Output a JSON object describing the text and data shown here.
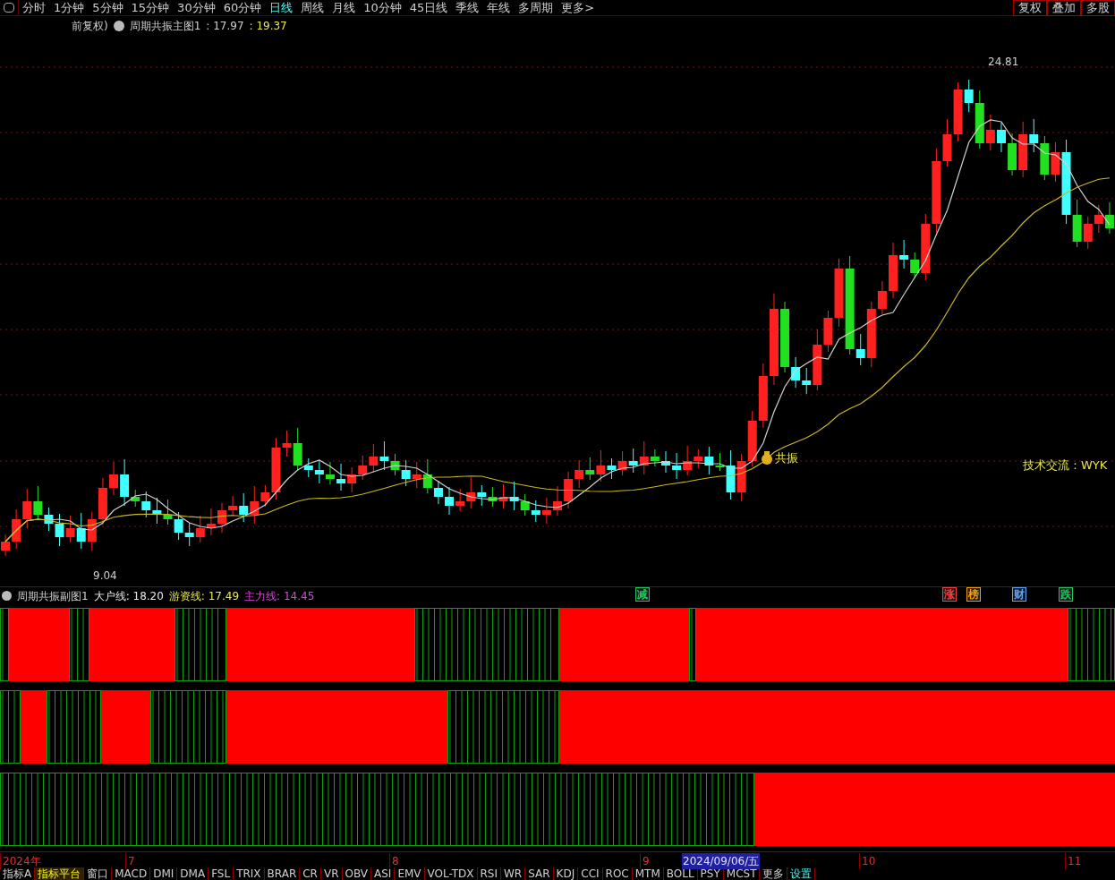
{
  "period_bar": {
    "items": [
      {
        "label": "分时",
        "selected": false
      },
      {
        "label": "1分钟",
        "selected": false
      },
      {
        "label": "5分钟",
        "selected": false
      },
      {
        "label": "15分钟",
        "selected": false
      },
      {
        "label": "30分钟",
        "selected": false
      },
      {
        "label": "60分钟",
        "selected": false
      },
      {
        "label": "日线",
        "selected": true
      },
      {
        "label": "周线",
        "selected": false
      },
      {
        "label": "月线",
        "selected": false
      },
      {
        "label": "10分钟",
        "selected": false
      },
      {
        "label": "45日线",
        "selected": false
      },
      {
        "label": "季线",
        "selected": false
      },
      {
        "label": "年线",
        "selected": false
      },
      {
        "label": "多周期",
        "selected": false
      },
      {
        "label": "更多>",
        "selected": false
      }
    ],
    "buttons": [
      "复权",
      "叠加",
      "多股"
    ]
  },
  "main_chart": {
    "header": {
      "adjust": "前复权)",
      "indicator": "周期共振主图1",
      "value_1": ": 17.97",
      "value_2": ": 19.37"
    },
    "high_label": "24.81",
    "low_label": "9.04",
    "signal_label": "共振",
    "note": "技术交流：WYK",
    "markers": [
      {
        "text": "减",
        "color": "#22c55e"
      },
      {
        "text": "涨",
        "color": "#ef4444"
      },
      {
        "text": "榜",
        "color": "#f59e0b"
      },
      {
        "text": "财",
        "color": "#60a5fa"
      },
      {
        "text": "跌",
        "color": "#22c55e"
      }
    ]
  },
  "sub_chart": {
    "title": "周期共振副图1",
    "values": [
      {
        "label": "大户线: 18.20",
        "color": "#e5e5e5"
      },
      {
        "label": "游资线: 17.49",
        "color": "#e8e84a"
      },
      {
        "label": "主力线: 14.45",
        "color": "#e040e0"
      }
    ]
  },
  "date_axis": [
    {
      "label": "2024年",
      "selected": false
    },
    {
      "label": "7",
      "selected": false
    },
    {
      "label": "8",
      "selected": false
    },
    {
      "label": "9",
      "selected": false
    },
    {
      "label": "2024/09/06/五",
      "selected": true
    },
    {
      "label": "10",
      "selected": false
    },
    {
      "label": "11",
      "selected": false
    }
  ],
  "indicator_tabs": [
    {
      "label": "指标A",
      "selected": false,
      "kind": "tab"
    },
    {
      "label": "指标平台",
      "selected": true,
      "kind": "tab"
    },
    {
      "label": "窗口",
      "selected": false,
      "kind": "tab"
    },
    {
      "label": "MACD",
      "selected": false,
      "kind": "tab"
    },
    {
      "label": "DMI",
      "selected": false,
      "kind": "tab"
    },
    {
      "label": "DMA",
      "selected": false,
      "kind": "tab"
    },
    {
      "label": "FSL",
      "selected": false,
      "kind": "tab"
    },
    {
      "label": "TRIX",
      "selected": false,
      "kind": "tab"
    },
    {
      "label": "BRAR",
      "selected": false,
      "kind": "tab"
    },
    {
      "label": "CR",
      "selected": false,
      "kind": "tab"
    },
    {
      "label": "VR",
      "selected": false,
      "kind": "tab"
    },
    {
      "label": "OBV",
      "selected": false,
      "kind": "tab"
    },
    {
      "label": "ASI",
      "selected": false,
      "kind": "tab"
    },
    {
      "label": "EMV",
      "selected": false,
      "kind": "tab"
    },
    {
      "label": "VOL-TDX",
      "selected": false,
      "kind": "tab"
    },
    {
      "label": "RSI",
      "selected": false,
      "kind": "tab"
    },
    {
      "label": "WR",
      "selected": false,
      "kind": "tab"
    },
    {
      "label": "SAR",
      "selected": false,
      "kind": "tab"
    },
    {
      "label": "KDJ",
      "selected": false,
      "kind": "tab"
    },
    {
      "label": "CCI",
      "selected": false,
      "kind": "tab"
    },
    {
      "label": "ROC",
      "selected": false,
      "kind": "tab"
    },
    {
      "label": "MTM",
      "selected": false,
      "kind": "tab"
    },
    {
      "label": "BOLL",
      "selected": false,
      "kind": "tab"
    },
    {
      "label": "PSY",
      "selected": false,
      "kind": "tab"
    },
    {
      "label": "MCST",
      "selected": false,
      "kind": "tab"
    },
    {
      "label": "更多",
      "selected": false,
      "kind": "tab"
    },
    {
      "label": "设置",
      "selected": false,
      "kind": "settings"
    }
  ]
}
